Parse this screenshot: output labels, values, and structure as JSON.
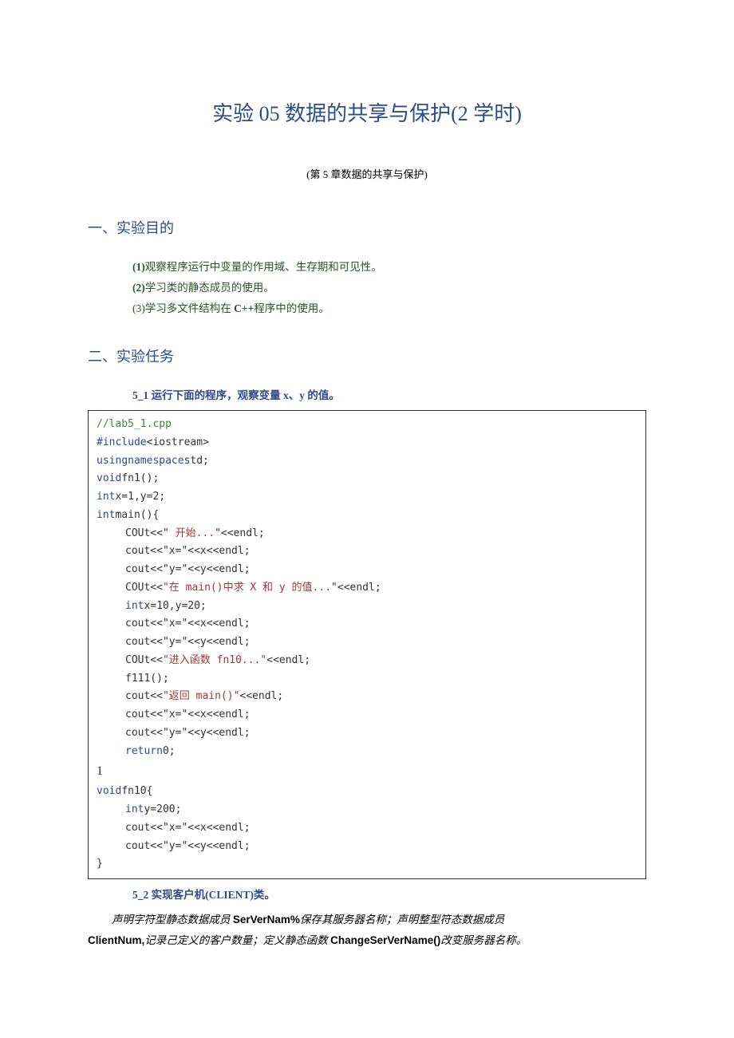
{
  "title": "实验 05 数据的共享与保护(2 学时)",
  "subtitle": "(第 5 章数据的共享与保护)",
  "section1": {
    "heading": "一、实验目的",
    "items": [
      {
        "label": "(1)",
        "text": "观察程序运行中变量的作用域、生存期和可见性。"
      },
      {
        "label": "(2)",
        "text": "学习类的静态成员的使用。"
      },
      {
        "label": "(3)",
        "text_pre": "学习多文件结构在 ",
        "cpp": "C++",
        "text_post": "程序中的使用。"
      }
    ]
  },
  "section2": {
    "heading": "二、实验任务",
    "task1": {
      "label": "5_1 ",
      "desc_pre": "运行下面的程序，观察变量 ",
      "xy": "x、y ",
      "desc_post": "的值。"
    },
    "code": {
      "l1": "//lab5_1.cpp",
      "l2a": "#include",
      "l2b": "<iostream>",
      "l3a": "usingnamespace",
      "l3b": "std;",
      "l4a": "void",
      "l4b": "fn1();",
      "l5a": "int",
      "l5b": "x=1,y=2;",
      "l6a": "int",
      "l6b": "main(){",
      "l7a": "COUt<<\"",
      "l7b": " 开始...",
      "l7c": "\"<<endl;",
      "l8": "cout<<\"x=\"<<x<<endl;",
      "l9": "cout<<\"y=\"<<y<<endl;",
      "l10a": "COUt<<",
      "l10b": "\"在 main()中求 X 和 y 的值...",
      "l10c": "\"<<endl;",
      "l11a": "int",
      "l11b": "x=10,y=20;",
      "l12": "cout<<\"x=\"<<x<<endl;",
      "l13": "cout<<\"y=\"<<y<<endl;",
      "l14a": "COUt<<",
      "l14b": "\"进入函数 fn10...\"",
      "l14c": "<<endl;",
      "l15": "f111();",
      "l16a": "cout<<",
      "l16b": "\"返回 main()\"",
      "l16c": "<<endl;",
      "l17": "cout<<\"x=\"<<x<<endl;",
      "l18": "cout<<\"y=\"<<y<<endl;",
      "l19a": "return",
      "l19b": "0;",
      "l20": "1",
      "l21a": "void",
      "l21b": "fn10{",
      "l22a": "int",
      "l22b": "y=200;",
      "l23": "cout<<\"x=\"<<x<<endl;",
      "l24": "cout<<\"y=\"<<y<<endl;",
      "l25": "}"
    },
    "task2": {
      "label": "5_2 ",
      "title_pre": "实现客户机",
      "client": "(CLIENT)",
      "title_post": "类。",
      "desc_l1_pre": "声明字符型静态数据成员 ",
      "serverName": "SerVerNam%",
      "desc_l1_post": "保存其服务器名称；声明整型符态数据成员",
      "clientNum": "ClientNum,",
      "desc_l2_mid": "记录己定义的客户数量；定义静态函数 ",
      "changeServer": "ChangeSerVerName()",
      "desc_l2_post": "改变服务器名称。"
    }
  }
}
